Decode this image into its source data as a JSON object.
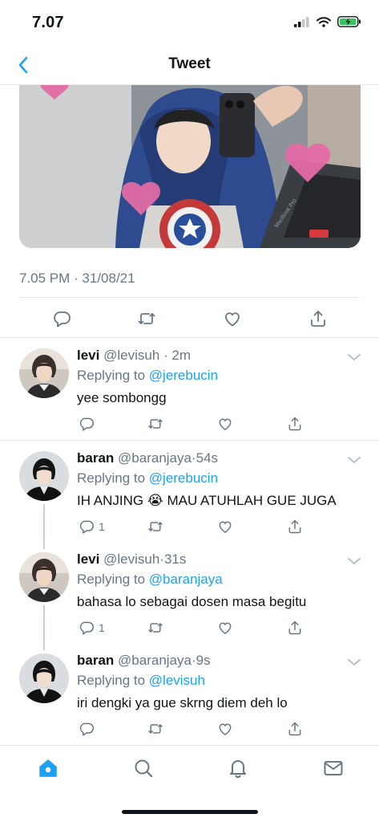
{
  "status_bar": {
    "time": "7.07"
  },
  "nav": {
    "title": "Tweet"
  },
  "tweet": {
    "timestamp": "7.05 PM · 31/08/21",
    "media_text": "MacBook Pro"
  },
  "replies": [
    {
      "name": "levi",
      "handle": "@levisuh",
      "time_sep": " · ",
      "time": "2m",
      "replying_prefix": "Replying to ",
      "replying_to": "@jerebucin",
      "text": "yee sombongg",
      "reply_count": "",
      "avatar": "levi-avatar"
    },
    {
      "name": "baran",
      "handle": "@baranjaya",
      "time_sep": "·",
      "time": "54s",
      "replying_prefix": "Replying to ",
      "replying_to": "@jerebucin",
      "text_before": "IH ANJING ",
      "emoji": "😭",
      "text_after": " MAU ATUHLAH GUE JUGA",
      "reply_count": "1",
      "avatar": "baran-avatar"
    },
    {
      "name": "levi",
      "handle": "@levisuh",
      "time_sep": "·",
      "time": "31s",
      "replying_prefix": "Replying to ",
      "replying_to": "@baranjaya",
      "text": "bahasa lo sebagai dosen masa begitu",
      "reply_count": "1",
      "avatar": "levi-avatar"
    },
    {
      "name": "baran",
      "handle": "@baranjaya",
      "time_sep": "·",
      "time": "9s",
      "replying_prefix": "Replying to ",
      "replying_to": "@levisuh",
      "text": "iri dengki ya gue skrng diem deh lo",
      "reply_count": "",
      "avatar": "baran-avatar"
    }
  ],
  "icons": {
    "back": "chevron-left-icon",
    "reply": "speech-bubble-icon",
    "retweet": "retweet-icon",
    "like": "heart-icon",
    "share": "share-icon",
    "tabs": [
      "home-icon",
      "search-icon",
      "bell-icon",
      "mail-icon"
    ]
  },
  "colors": {
    "accent": "#1da1f2",
    "muted": "#657786",
    "text": "#0f1419",
    "divider": "#e1e8ed"
  }
}
